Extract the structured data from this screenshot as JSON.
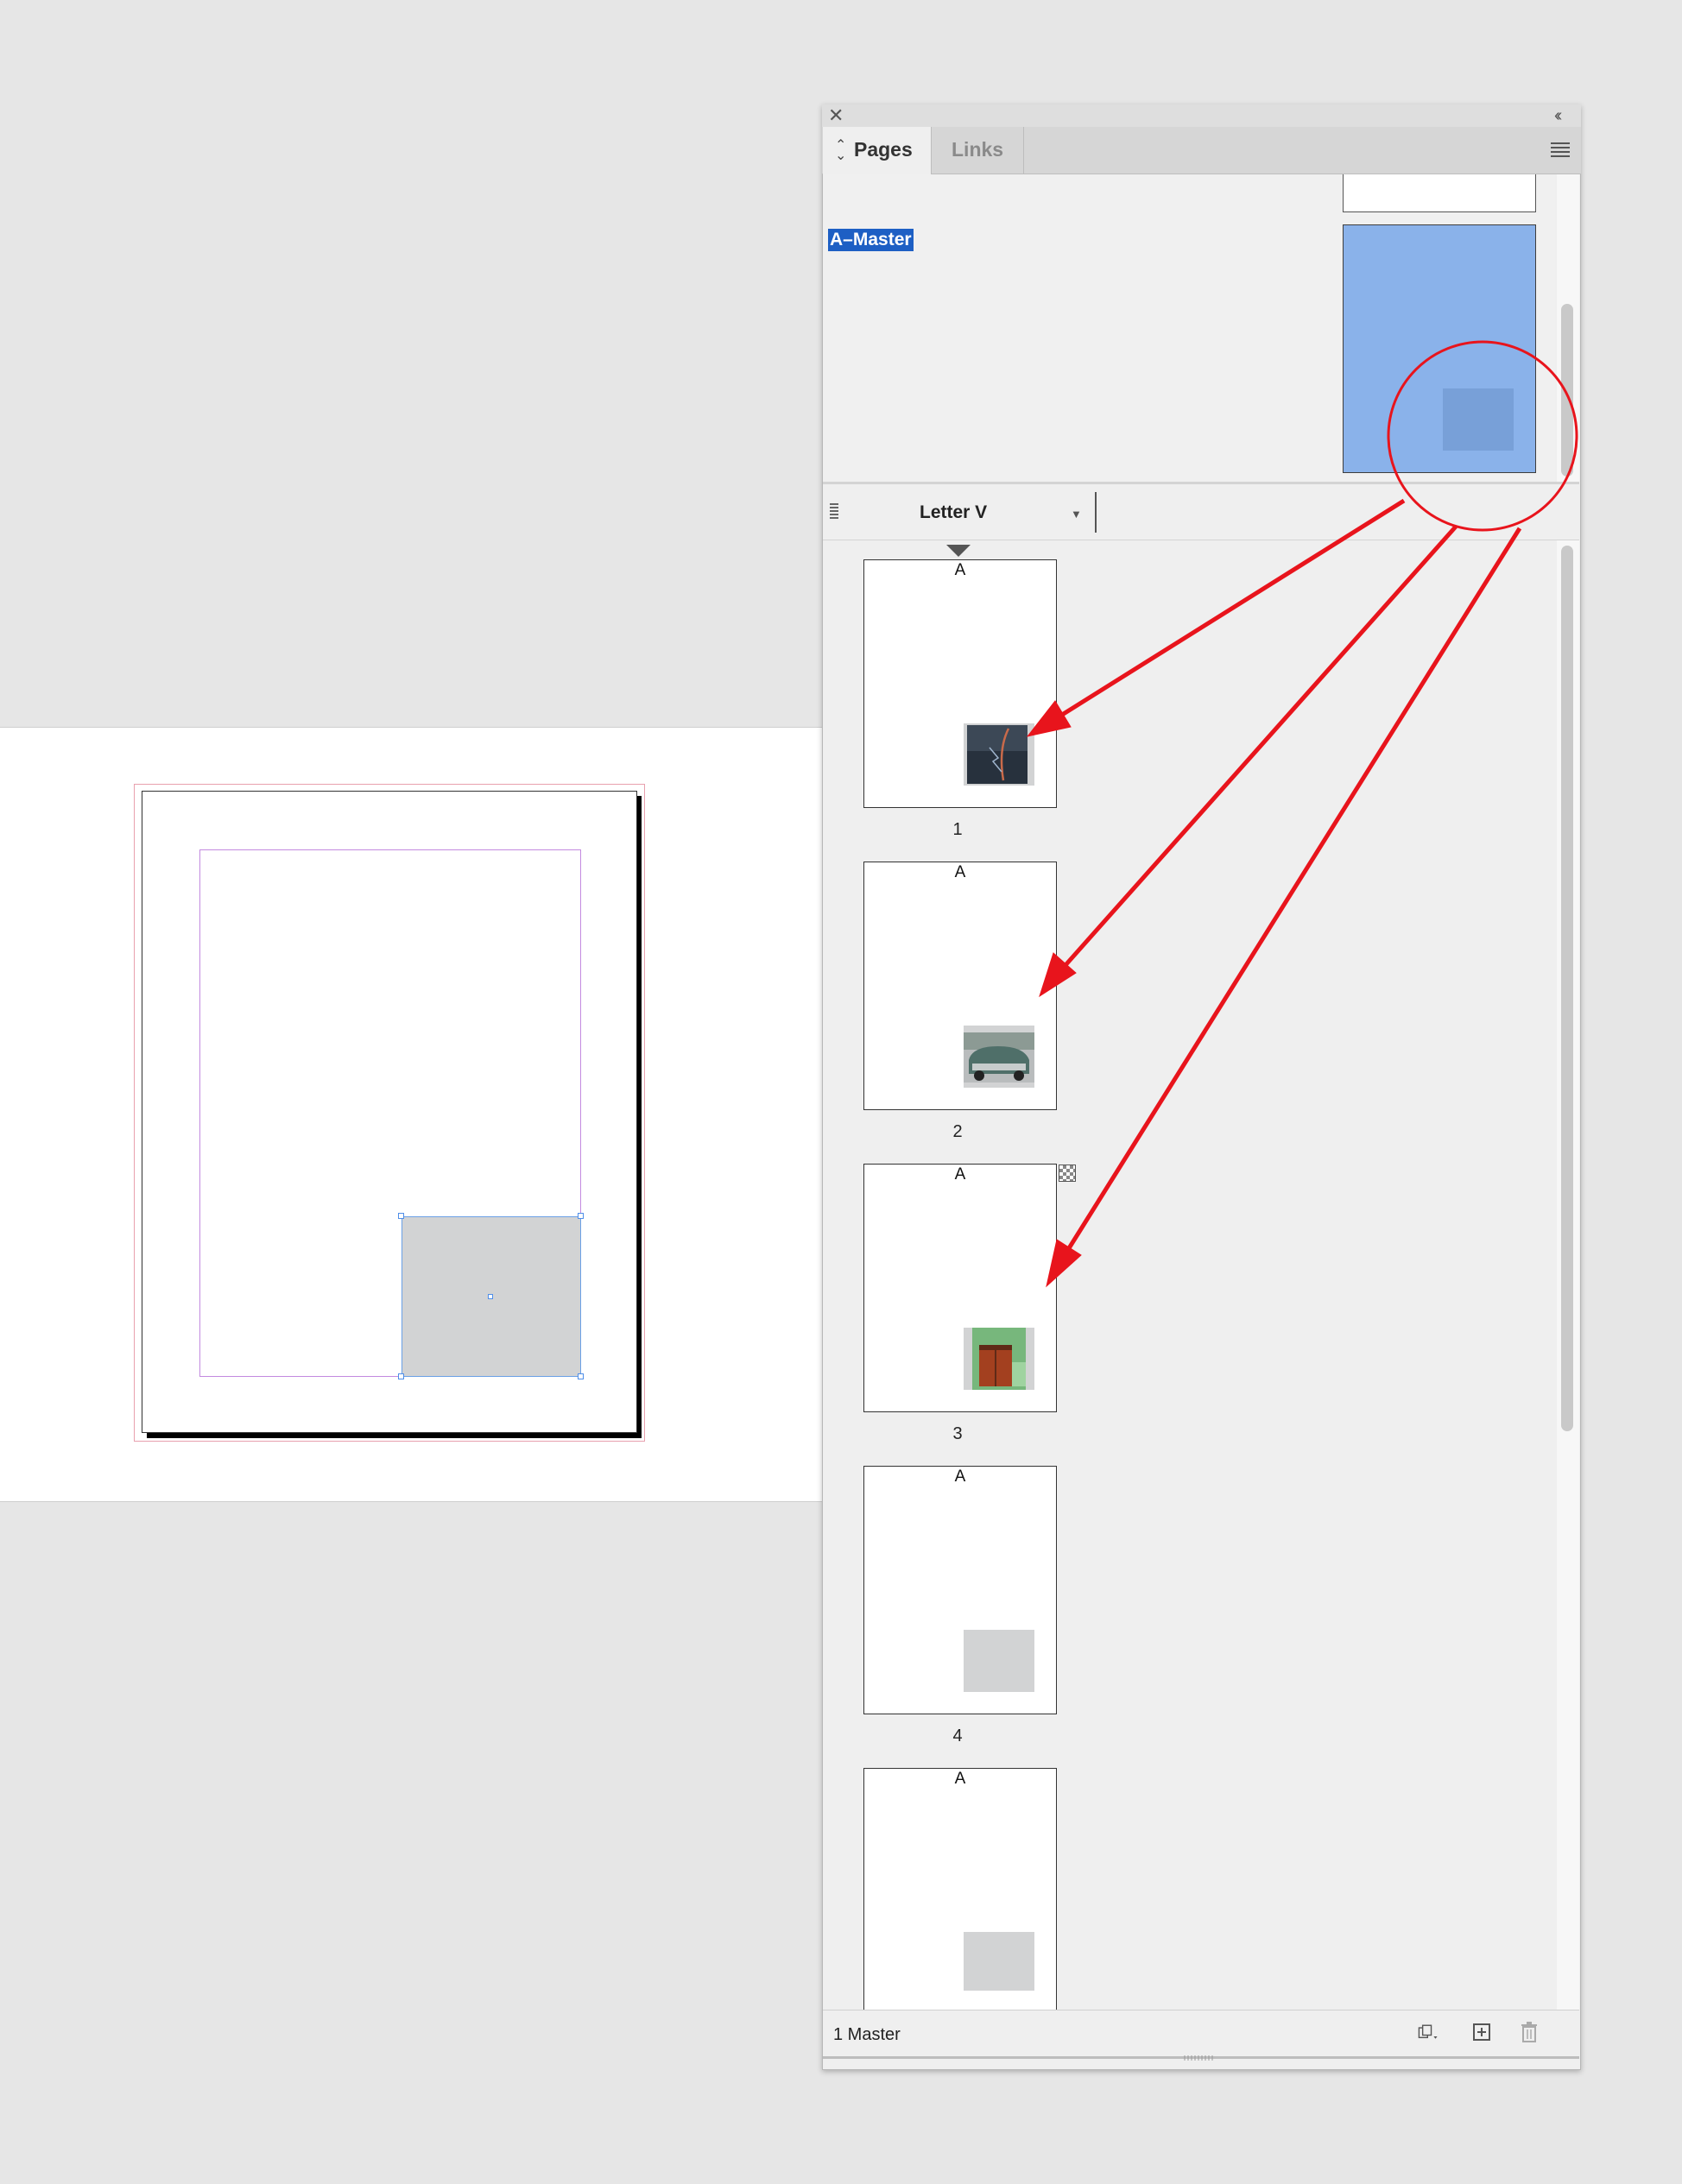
{
  "panel": {
    "tabs": [
      {
        "label": "Pages",
        "active": true
      },
      {
        "label": "Links",
        "active": false
      }
    ],
    "close_icon": "✕",
    "collapse_icon": "‹‹",
    "master": {
      "label": "A–Master",
      "thumbnail_color": "#8ab2ea"
    },
    "page_size": {
      "label": "Letter V"
    },
    "pages": [
      {
        "number": "1",
        "prefix": "A",
        "content": "photo-lightning"
      },
      {
        "number": "2",
        "prefix": "A",
        "content": "photo-vintage-car"
      },
      {
        "number": "3",
        "prefix": "A",
        "content": "photo-green-door"
      },
      {
        "number": "4",
        "prefix": "A",
        "content": "empty-frame"
      },
      {
        "number": "",
        "prefix": "A",
        "content": "empty-frame"
      }
    ],
    "footer": {
      "count_label": "1 Master"
    }
  },
  "colors": {
    "annotation": "#e8141c",
    "selection": "#1d5fc4",
    "frame_fill": "#d2d3d4"
  }
}
